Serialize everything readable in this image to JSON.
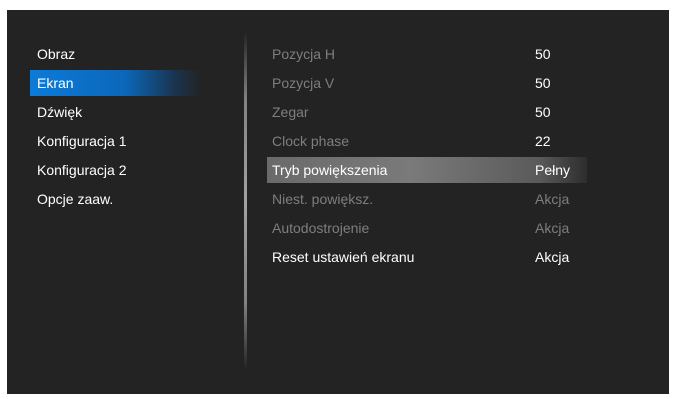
{
  "left_menu": {
    "items": [
      {
        "label": "Obraz"
      },
      {
        "label": "Ekran"
      },
      {
        "label": "Dźwięk"
      },
      {
        "label": "Konfiguracja 1"
      },
      {
        "label": "Konfiguracja 2"
      },
      {
        "label": "Opcje zaaw."
      }
    ],
    "selected_index": 1
  },
  "settings": {
    "rows": [
      {
        "label": "Pozycja H",
        "value": "50"
      },
      {
        "label": "Pozycja V",
        "value": "50"
      },
      {
        "label": "Zegar",
        "value": "50"
      },
      {
        "label": "Clock phase",
        "value": "22"
      },
      {
        "label": "Tryb powiększenia",
        "value": "Pełny"
      },
      {
        "label": "Niest. powiększ.",
        "value": "Akcja"
      },
      {
        "label": "Autodostrojenie",
        "value": "Akcja"
      },
      {
        "label": "Reset ustawień ekranu",
        "value": "Akcja"
      }
    ],
    "highlighted_index": 4
  },
  "colors": {
    "background": "#232323",
    "menu_selected": "#0b6fcc",
    "row_highlight": "#747474",
    "disabled_text": "#7e7e7e",
    "text": "#ffffff"
  }
}
